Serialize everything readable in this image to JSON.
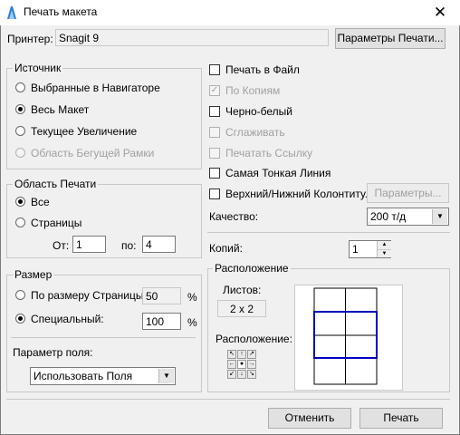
{
  "window": {
    "title": "Печать макета"
  },
  "printer": {
    "label": "Принтер:",
    "name": "Snagit 9",
    "settings_button": "Параметры Печати..."
  },
  "source": {
    "title": "Источник",
    "options": [
      {
        "label": "Выбранные в Навигаторе",
        "selected": false,
        "enabled": true
      },
      {
        "label": "Весь Макет",
        "selected": true,
        "enabled": true
      },
      {
        "label": "Текущее Увеличение",
        "selected": false,
        "enabled": true
      },
      {
        "label": "Область Бегущей Рамки",
        "selected": false,
        "enabled": false
      }
    ]
  },
  "print_area": {
    "title": "Область Печати",
    "all_label": "Все",
    "pages_label": "Страницы",
    "from_label": "От:",
    "from_value": "1",
    "to_label": "по:",
    "to_value": "4"
  },
  "options": {
    "print_to_file": "Печать в Файл",
    "by_copies": "По Копиям",
    "bw": "Черно-белый",
    "smooth": "Сглаживать",
    "print_link": "Печатать Ссылку",
    "thinnest_line": "Самая Тонкая Линия",
    "header_footer": "Верхний/Нижний Колонтитул",
    "params_button": "Параметры...",
    "quality_label": "Качество:",
    "quality_value": "200 т/д",
    "copies_label": "Копий:",
    "copies_value": "1"
  },
  "size": {
    "title": "Размер",
    "fit_label": "По размеру Страницы:",
    "fit_value": "50",
    "custom_label": "Специальный:",
    "custom_value": "100",
    "percent": "%"
  },
  "margins": {
    "label": "Параметр поля:",
    "value": "Использовать Поля Принте"
  },
  "layout": {
    "title": "Расположение",
    "sheets_label": "Листов:",
    "sheets_value": "2 x 2",
    "position_label": "Расположение:"
  },
  "footer": {
    "cancel": "Отменить",
    "print": "Печать"
  }
}
